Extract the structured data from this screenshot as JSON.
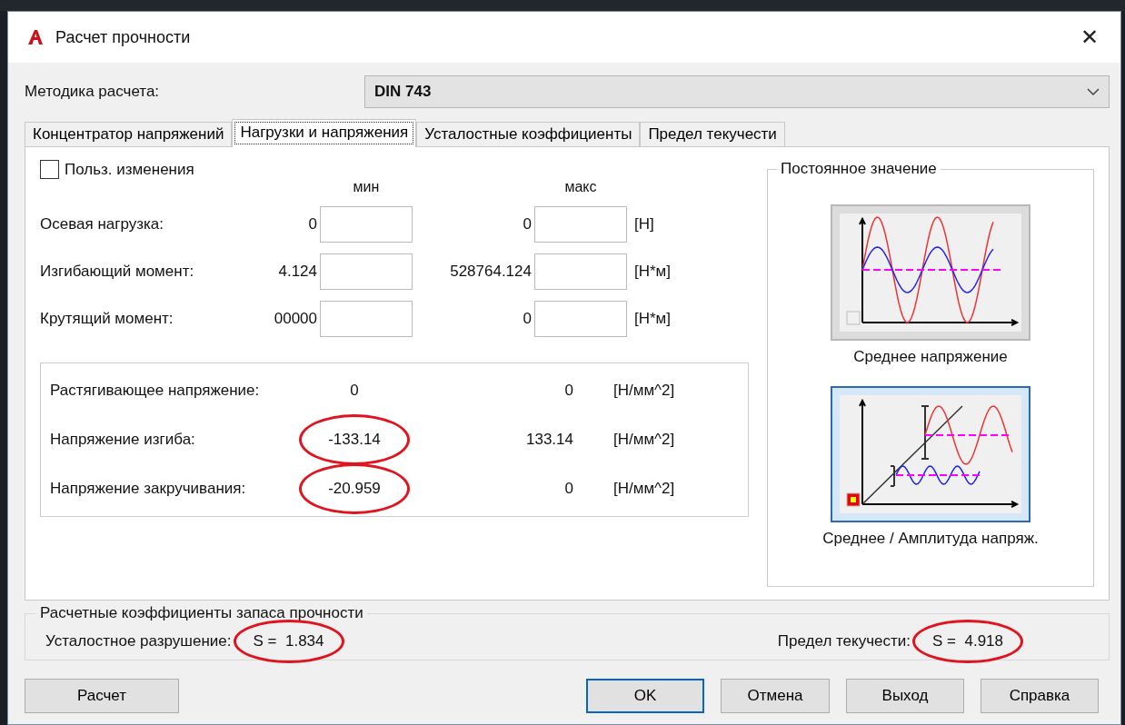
{
  "window": {
    "title": "Расчет прочности",
    "close": "✕"
  },
  "method": {
    "label": "Методика расчета:",
    "value": "DIN 743"
  },
  "tabs": [
    {
      "label": "Концентратор напряжений",
      "selected": false
    },
    {
      "label": "Нагрузки и напряжения",
      "selected": true
    },
    {
      "label": "Усталостные коэффициенты",
      "selected": false
    },
    {
      "label": "Предел текучести",
      "selected": false
    }
  ],
  "user_changes": {
    "label": "Польз. изменения",
    "checked": false
  },
  "columns": [
    "мин",
    "макс"
  ],
  "loads": [
    {
      "label": "Осевая нагрузка:",
      "min": "0",
      "max": "0",
      "unit": "[Н]"
    },
    {
      "label": "Изгибающий момент:",
      "min": "4.124",
      "max": "528764.124",
      "unit": "[Н*м]"
    },
    {
      "label": "Крутящий момент:",
      "min": "00000",
      "max": "0",
      "unit": "[Н*м]"
    }
  ],
  "stresses": [
    {
      "label": "Растягивающее напряжение:",
      "min": "0",
      "max": "0",
      "unit": "[Н/мм^2]",
      "circled": false
    },
    {
      "label": "Напряжение изгиба:",
      "min": "-133.14",
      "max": "133.14",
      "unit": "[Н/мм^2]",
      "circled": true
    },
    {
      "label": "Напряжение закручивания:",
      "min": "-20.959",
      "max": "0",
      "unit": "[Н/мм^2]",
      "circled": true
    }
  ],
  "mean_value": {
    "title": "Постоянное значение",
    "options": [
      {
        "kind": "mean",
        "label": "Среднее напряжение",
        "selected": false
      },
      {
        "kind": "amplitude",
        "label": "Среднее / Амплитуда напряж.",
        "selected": true
      }
    ]
  },
  "safety": {
    "title": "Расчетные коэффициенты запаса прочности",
    "items": [
      {
        "label": "Усталостное разрушение:",
        "value": "S =  1.834",
        "circled": true
      },
      {
        "label": "Предел текучести:",
        "value": "S =  4.918",
        "circled": true
      }
    ]
  },
  "buttons": [
    {
      "label": "Расчет",
      "default": false
    },
    {
      "label": "OK",
      "default": true
    },
    {
      "label": "Отмена",
      "default": false
    },
    {
      "label": "Выход",
      "default": false
    },
    {
      "label": "Справка",
      "default": false
    }
  ]
}
